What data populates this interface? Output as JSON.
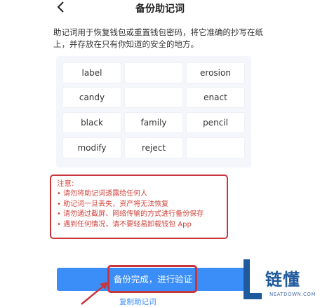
{
  "header": {
    "title": "备份助记词",
    "back_icon": "chevron-left-icon"
  },
  "description": "助记词用于恢复钱包或重置钱包密码，将它准确的抄写在纸上，并存放在只有你知道的安全的地方。",
  "mnemonic": {
    "words": [
      "label",
      "",
      "erosion",
      "candy",
      "",
      "enact",
      "black",
      "family",
      "pencil",
      "modify",
      "reject",
      ""
    ]
  },
  "notice": {
    "title": "注意:",
    "items": [
      "• 请勿将助记词透露给任何人",
      "• 助记词一旦丢失，资产将无法恢复",
      "• 请勿通过截屏、网络传输的方式进行备份保存",
      "• 遇到任何情况，请不要轻易卸载钱包 App"
    ]
  },
  "actions": {
    "confirm_label": "备份完成，进行验证",
    "copy_label": "复制助记词"
  },
  "watermark": {
    "name": "链懂",
    "domain": "NEATDOWN.COM"
  },
  "colors": {
    "accent": "#3b8ef7",
    "alert": "#c8363c",
    "panel": "#f4f6fb"
  }
}
